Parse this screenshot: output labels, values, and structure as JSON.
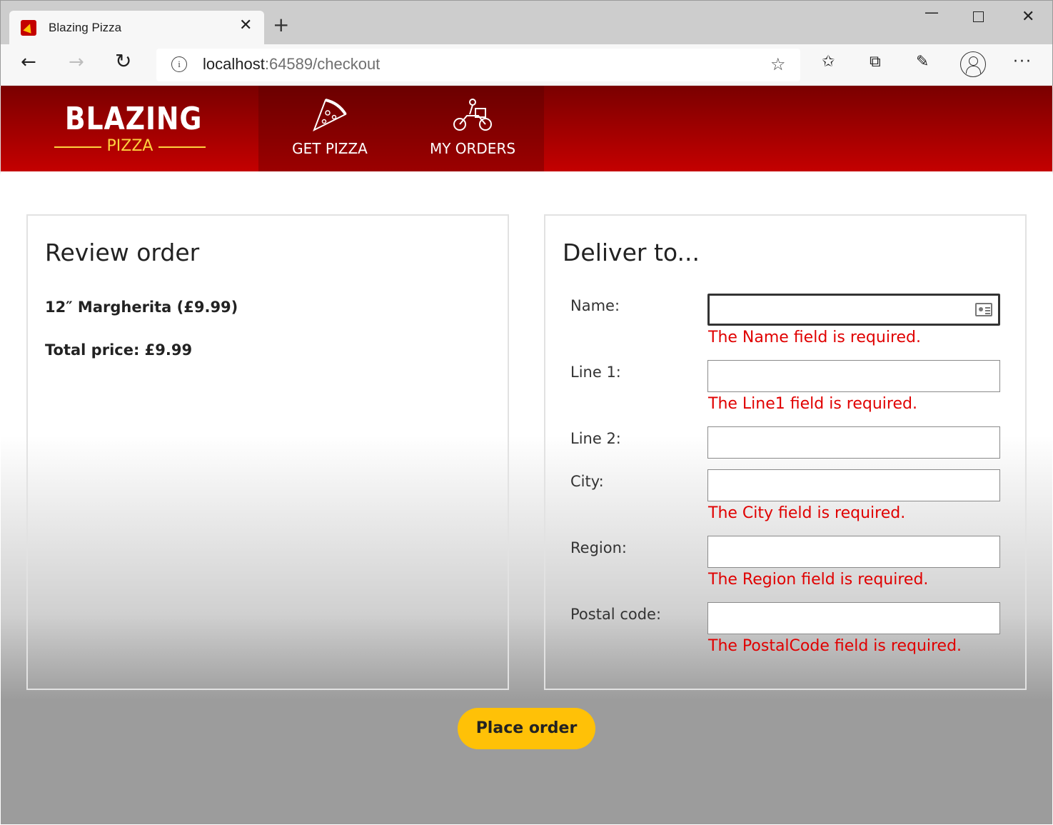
{
  "browser": {
    "tab_title": "Blazing Pizza",
    "url_host": "localhost",
    "url_path": ":64589/checkout"
  },
  "header": {
    "logo_main": "BLAZING",
    "logo_sub": "PIZZA",
    "nav": [
      {
        "label": "GET PIZZA",
        "icon": "pizza-slice-icon"
      },
      {
        "label": "MY ORDERS",
        "icon": "motorbike-icon"
      }
    ]
  },
  "review": {
    "title": "Review order",
    "item": "12″ Margherita (£9.99)",
    "total": "Total price: £9.99"
  },
  "delivery": {
    "title": "Deliver to...",
    "fields": [
      {
        "label": "Name:",
        "value": "",
        "error": "The Name field is required."
      },
      {
        "label": "Line 1:",
        "value": "",
        "error": "The Line1 field is required."
      },
      {
        "label": "Line 2:",
        "value": "",
        "error": ""
      },
      {
        "label": "City:",
        "value": "",
        "error": "The City field is required."
      },
      {
        "label": "Region:",
        "value": "",
        "error": "The Region field is required."
      },
      {
        "label": "Postal code:",
        "value": "",
        "error": "The PostalCode field is required."
      }
    ]
  },
  "actions": {
    "place_order": "Place order"
  },
  "colors": {
    "header_dark": "#7a0000",
    "header_light": "#c40000",
    "accent": "#ffc107",
    "error": "#e00000"
  }
}
